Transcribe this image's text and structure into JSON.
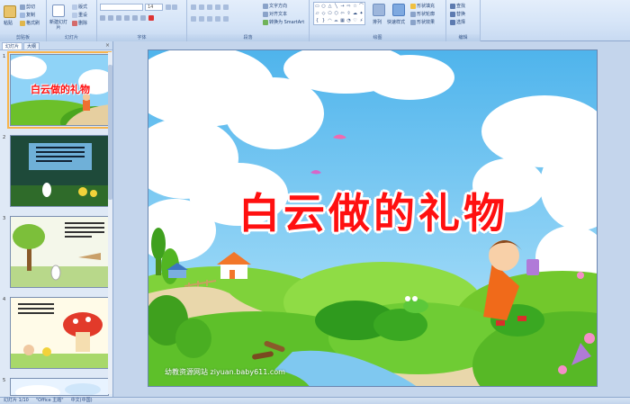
{
  "ribbon": {
    "groups": [
      {
        "label": "剪贴板",
        "items": [
          "粘贴",
          "剪切",
          "复制",
          "格式刷"
        ]
      },
      {
        "label": "幻灯片",
        "items": [
          "新建幻灯片",
          "版式",
          "重设",
          "删除"
        ]
      },
      {
        "label": "字体",
        "font_size": "14"
      },
      {
        "label": "段落",
        "items": [
          "文字方向",
          "对齐文本",
          "转换为 SmartArt"
        ]
      },
      {
        "label": "绘图",
        "items": [
          "排列",
          "快速样式",
          "形状填充",
          "形状轮廓",
          "形状效果"
        ]
      },
      {
        "label": "编辑",
        "items": [
          "查找",
          "替换",
          "选择"
        ]
      }
    ]
  },
  "panel": {
    "tabs": [
      "幻灯片",
      "大纲"
    ],
    "close_glyph": "×",
    "thumb_numbers": [
      "1",
      "2",
      "3",
      "4",
      "5"
    ]
  },
  "slide": {
    "title": "白云做的礼物",
    "footer": "幼教资源网站 ziyuan.baby611.com"
  },
  "thumb1_title": "白云做的礼物",
  "status": {
    "slide_count": "幻灯片 1/10",
    "theme": "\"Office 主题\"",
    "language": "中文(中国)"
  },
  "colors": {
    "title_red": "#ff1010",
    "sky": "#8fd3f7",
    "grass": "#6cc02a",
    "ribbon": "#d5e4f7"
  }
}
